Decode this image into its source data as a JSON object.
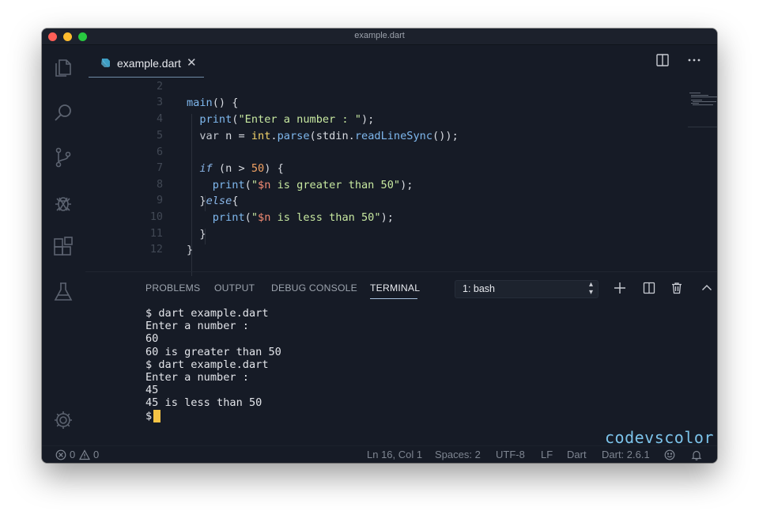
{
  "window": {
    "title": "example.dart"
  },
  "tab": {
    "label": "example.dart",
    "close": "✕"
  },
  "code": {
    "lines": [
      {
        "num": "2"
      },
      {
        "num": "3"
      },
      {
        "num": "4"
      },
      {
        "num": "5"
      },
      {
        "num": "6"
      },
      {
        "num": "7"
      },
      {
        "num": "8"
      },
      {
        "num": "9"
      },
      {
        "num": "10"
      },
      {
        "num": "11"
      },
      {
        "num": "12"
      }
    ]
  },
  "panel": {
    "tabs": [
      "PROBLEMS",
      "OUTPUT",
      "DEBUG CONSOLE",
      "TERMINAL"
    ],
    "active_tab": "TERMINAL",
    "terminal_select": "1: bash"
  },
  "terminal": {
    "lines": [
      "$ dart example.dart",
      "Enter a number :",
      "60",
      "60 is greater than 50",
      "$ dart example.dart",
      "Enter a number :",
      "45",
      "45 is less than 50",
      "$"
    ]
  },
  "watermark": "codevscolor.com",
  "statusbar": {
    "errors": "0",
    "warnings": "0",
    "position": "Ln 16, Col 1",
    "spaces": "Spaces: 2",
    "encoding": "UTF-8",
    "eol": "LF",
    "language": "Dart",
    "sdk": "Dart: 2.6.1"
  },
  "icons": {
    "activity": [
      "files-icon",
      "search-icon",
      "source-control-icon",
      "debug-icon",
      "extensions-icon",
      "testing-icon",
      "settings-gear-icon"
    ]
  },
  "colors": {
    "background": "#161b26",
    "cursor": "#f5c345",
    "accent_string": "#c7e8a0",
    "accent_function": "#7fb8ee"
  }
}
